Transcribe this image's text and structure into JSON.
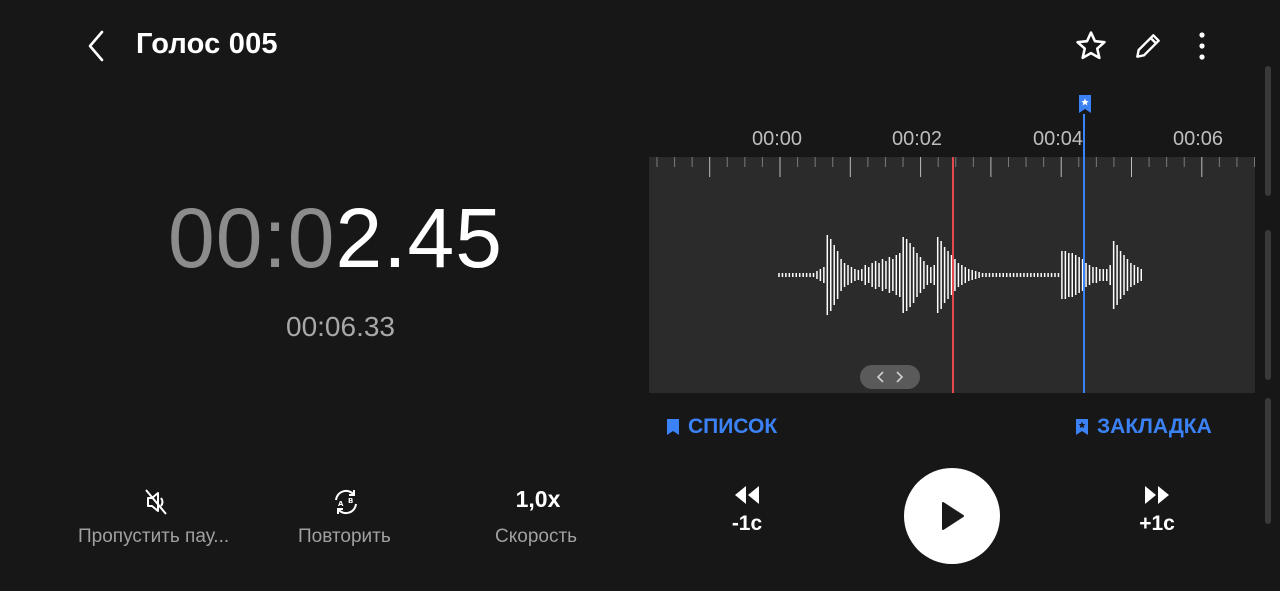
{
  "header": {
    "title": "Голос 005"
  },
  "timer": {
    "elapsed_dim": "00:0",
    "elapsed_bright": "2.45",
    "total": "00:06.33"
  },
  "timeline": {
    "ticks": [
      "00:00",
      "00:02",
      "00:04",
      "00:06"
    ]
  },
  "actions": {
    "list_label": "СПИСОК",
    "bookmark_label": "ЗАКЛАДКА"
  },
  "controls": {
    "skip_silence_label": "Пропустить пау...",
    "repeat_label": "Повторить",
    "speed_value": "1,0x",
    "speed_label": "Скорость",
    "rewind_label": "-1с",
    "forward_label": "+1с"
  },
  "colors": {
    "playhead": "#e5484d",
    "bookmark": "#3b82f6",
    "background": "#171717"
  },
  "icons": [
    "back-icon",
    "star-icon",
    "pencil-icon",
    "more-icon",
    "bookmark-icon",
    "skip-silence-icon",
    "repeat-ab-icon",
    "rewind-icon",
    "forward-icon",
    "play-icon"
  ]
}
